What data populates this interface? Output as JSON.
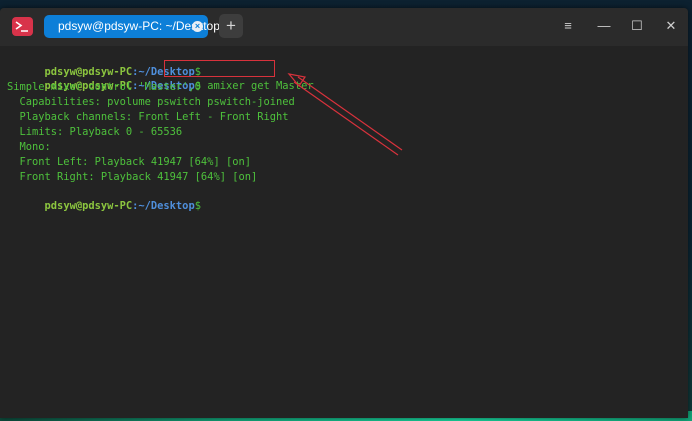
{
  "window": {
    "tab_title": "pdsyw@pdsyw-PC: ~/Desktop",
    "new_tab_label": "+",
    "menu_icon": "≡",
    "minimize_icon": "—",
    "maximize_icon": "☐",
    "close_icon": "✕",
    "app_icon": "terminal-icon"
  },
  "terminal": {
    "prompt_user": "pdsyw@pdsyw-PC",
    "prompt_path": ":~/Desktop",
    "prompt_suffix": "$",
    "command": "amixer get Master",
    "output": [
      "Simple mixer control 'Master',0",
      "  Capabilities: pvolume pswitch pswitch-joined",
      "  Playback channels: Front Left - Front Right",
      "  Limits: Playback 0 - 65536",
      "  Mono:",
      "  Front Left: Playback 41947 [64%] [on]",
      "  Front Right: Playback 41947 [64%] [on]"
    ]
  },
  "colors": {
    "tab_accent": "#0d7fd8",
    "prompt_user": "#8cc63f",
    "prompt_path": "#4f8fdc",
    "output_text": "#4ec13c",
    "annotation": "#d8323c"
  }
}
